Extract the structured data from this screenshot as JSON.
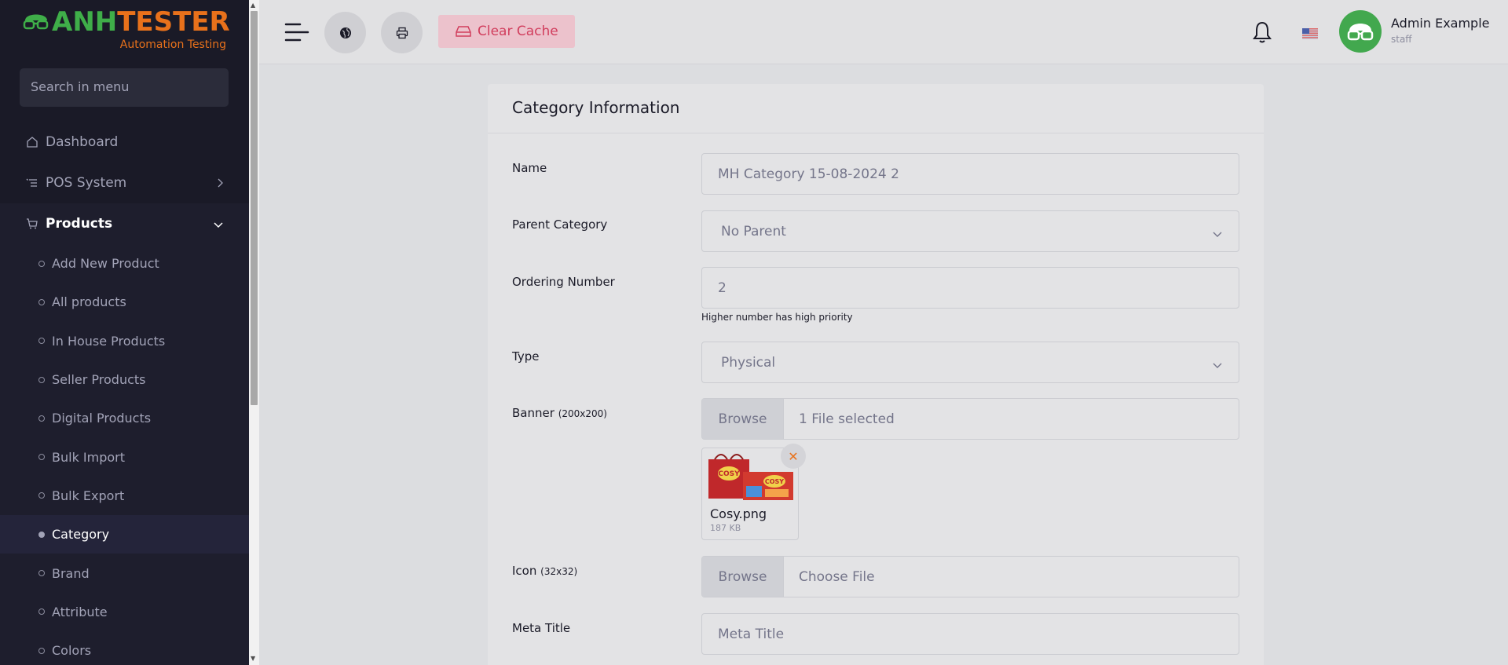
{
  "brand": {
    "logo_main_green": "ANH",
    "logo_main_orange": "TESTER",
    "logo_sub": "Automation Testing"
  },
  "search": {
    "placeholder": "Search in menu"
  },
  "nav": {
    "dashboard": "Dashboard",
    "pos": "POS System",
    "products": "Products",
    "sub_items": [
      "Add New Product",
      "All products",
      "In House Products",
      "Seller Products",
      "Digital Products",
      "Bulk Import",
      "Bulk Export",
      "Category",
      "Brand",
      "Attribute",
      "Colors"
    ]
  },
  "topbar": {
    "clear_cache": "Clear Cache",
    "user_name": "Admin Example",
    "user_role": "staff"
  },
  "form": {
    "title": "Category Information",
    "name_label": "Name",
    "name_value": "MH Category 15-08-2024 2",
    "parent_label": "Parent Category",
    "parent_value": "No Parent",
    "ordering_label": "Ordering Number",
    "ordering_value": "2",
    "ordering_hint": "Higher number has high priority",
    "type_label": "Type",
    "type_value": "Physical",
    "banner_label": "Banner",
    "banner_size": "(200x200)",
    "browse": "Browse",
    "banner_file": "1 File selected",
    "thumb_name": "Cosy.png",
    "thumb_size": "187 KB",
    "icon_label": "Icon",
    "icon_size": "(32x32)",
    "icon_file": "Choose File",
    "meta_label": "Meta Title",
    "meta_placeholder": "Meta Title"
  },
  "colors": {
    "sidebar_bg": "#1a1a27",
    "accent_green": "#3fae49",
    "accent_orange": "#e8711b",
    "danger": "#d13e5d"
  }
}
